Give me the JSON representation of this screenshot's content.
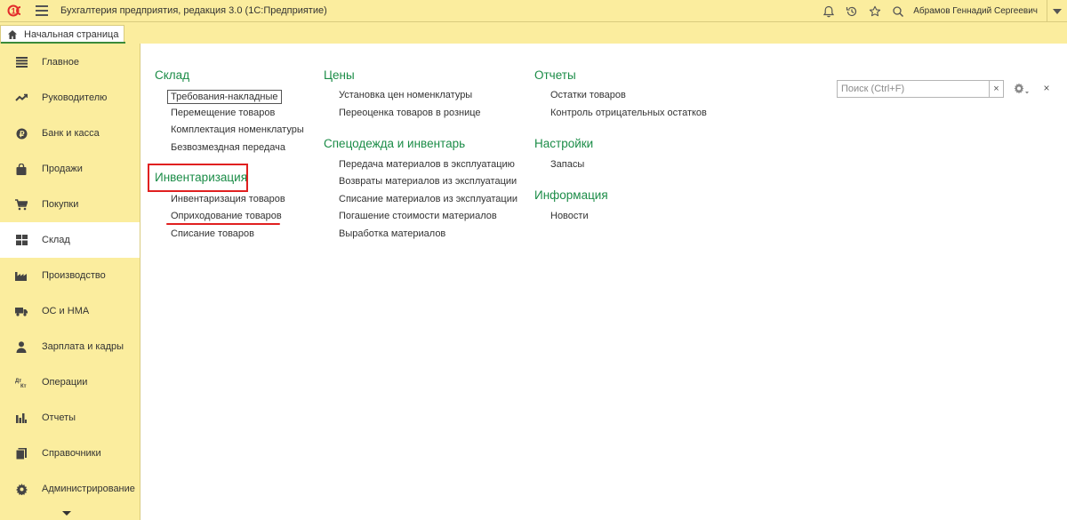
{
  "app": {
    "title": "Бухгалтерия предприятия, редакция 3.0  (1С:Предприятие)",
    "user": "Абрамов Геннадий Сергеевич"
  },
  "tabs": {
    "home": "Начальная страница"
  },
  "sidebar": {
    "items": [
      {
        "label": "Главное",
        "icon": "list-icon"
      },
      {
        "label": "Руководителю",
        "icon": "trend-icon"
      },
      {
        "label": "Банк и касса",
        "icon": "coin-icon"
      },
      {
        "label": "Продажи",
        "icon": "bag-icon"
      },
      {
        "label": "Покупки",
        "icon": "cart-icon"
      },
      {
        "label": "Склад",
        "icon": "warehouse-icon",
        "active": true
      },
      {
        "label": "Производство",
        "icon": "factory-icon"
      },
      {
        "label": "ОС и НМА",
        "icon": "truck-icon"
      },
      {
        "label": "Зарплата и кадры",
        "icon": "person-icon"
      },
      {
        "label": "Операции",
        "icon": "debit-credit-icon"
      },
      {
        "label": "Отчеты",
        "icon": "bar-chart-icon"
      },
      {
        "label": "Справочники",
        "icon": "books-icon"
      },
      {
        "label": "Администрирование",
        "icon": "gear-icon"
      }
    ]
  },
  "search": {
    "placeholder": "Поиск (Ctrl+F)",
    "clear_label": "×"
  },
  "close_label": "×",
  "sections": {
    "sklad": {
      "title": "Склад",
      "links": [
        "Требования-накладные",
        "Перемещение товаров",
        "Комплектация номенклатуры",
        "Безвозмездная передача"
      ]
    },
    "inventarizaciya": {
      "title": "Инвентаризация",
      "links": [
        "Инвентаризация товаров",
        "Оприходование товаров",
        "Списание товаров"
      ]
    },
    "ceny": {
      "title": "Цены",
      "links": [
        "Установка цен номенклатуры",
        "Переоценка товаров в рознице"
      ]
    },
    "specodezhda": {
      "title": "Спецодежда и инвентарь",
      "links": [
        "Передача материалов в эксплуатацию",
        "Возвраты материалов из эксплуатации",
        "Списание материалов из эксплуатации",
        "Погашение стоимости материалов",
        "Выработка материалов"
      ]
    },
    "otchety": {
      "title": "Отчеты",
      "links": [
        "Остатки товаров",
        "Контроль отрицательных остатков"
      ]
    },
    "nastroyki": {
      "title": "Настройки",
      "links": [
        "Запасы"
      ]
    },
    "informaciya": {
      "title": "Информация",
      "links": [
        "Новости"
      ]
    }
  },
  "colors": {
    "panel_bg": "#fbed9e",
    "section_title": "#1b8c47",
    "annotation": "#e02020"
  }
}
